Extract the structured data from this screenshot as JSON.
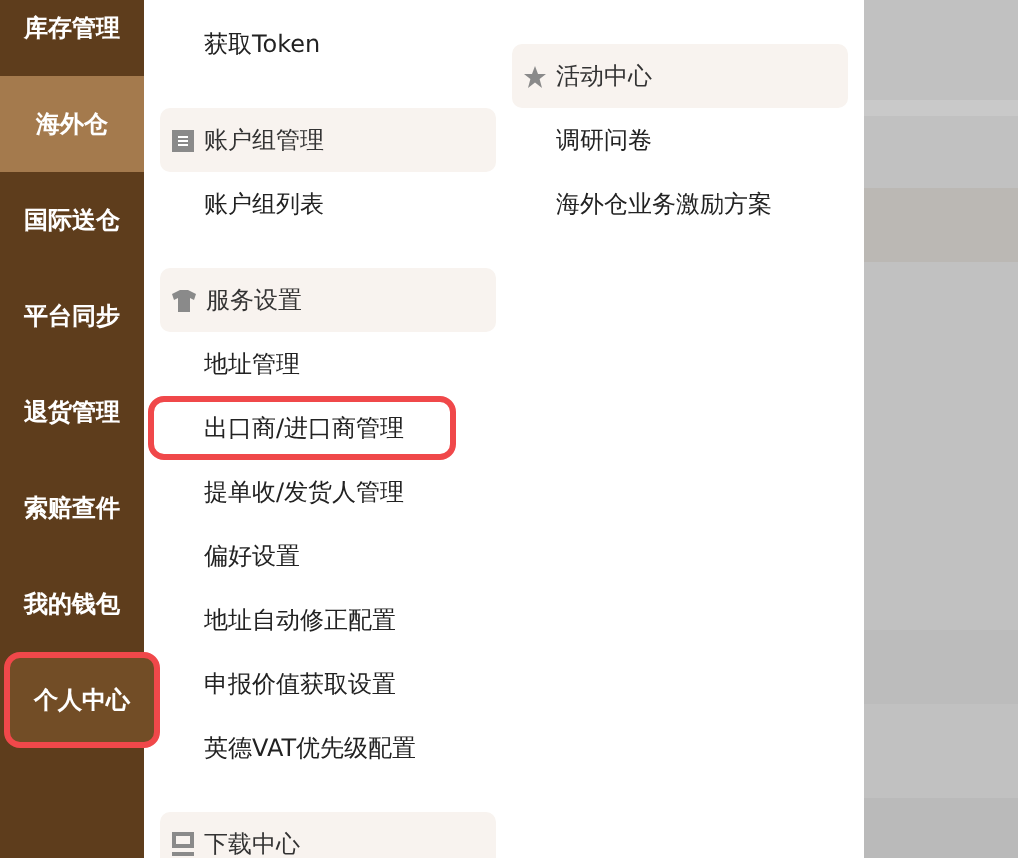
{
  "sidebar": {
    "items": [
      {
        "label": "库存管理",
        "selected": false,
        "highlighted": false
      },
      {
        "label": "海外仓",
        "selected": true,
        "highlighted": false
      },
      {
        "label": "国际送仓",
        "selected": false,
        "highlighted": false
      },
      {
        "label": "平台同步",
        "selected": false,
        "highlighted": false
      },
      {
        "label": "退货管理",
        "selected": false,
        "highlighted": false
      },
      {
        "label": "索赔查件",
        "selected": false,
        "highlighted": false
      },
      {
        "label": "我的钱包",
        "selected": false,
        "highlighted": false
      },
      {
        "label": "个人中心",
        "selected": false,
        "highlighted": true
      }
    ]
  },
  "menu": {
    "columns": [
      {
        "sections": [
          {
            "items": [
              {
                "label": "获取Token",
                "highlighted": false
              }
            ]
          },
          {
            "title": "账户组管理",
            "items": [
              {
                "label": "账户组列表",
                "highlighted": false
              }
            ]
          },
          {
            "title": "服务设置",
            "items": [
              {
                "label": "地址管理",
                "highlighted": false
              },
              {
                "label": "出口商/进口商管理",
                "highlighted": true
              },
              {
                "label": "提单收/发货人管理",
                "highlighted": false
              },
              {
                "label": "偏好设置",
                "highlighted": false
              },
              {
                "label": "地址自动修正配置",
                "highlighted": false
              },
              {
                "label": "申报价值获取设置",
                "highlighted": false
              },
              {
                "label": "英德VAT优先级配置",
                "highlighted": false
              }
            ]
          },
          {
            "title": "下载中心"
          }
        ]
      },
      {
        "sections": [
          {
            "title": "活动中心",
            "items": [
              {
                "label": "调研问卷",
                "highlighted": false
              },
              {
                "label": "海外仓业务激励方案",
                "highlighted": false
              }
            ]
          }
        ]
      }
    ]
  }
}
